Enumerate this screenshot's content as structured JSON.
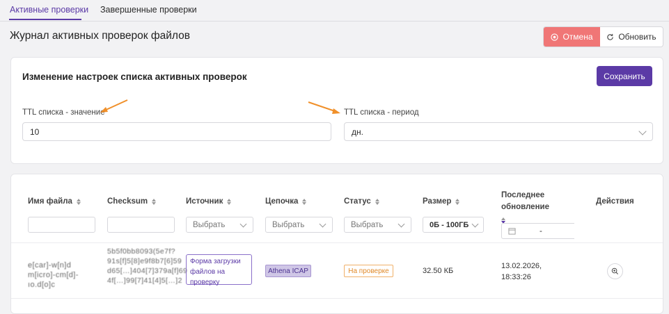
{
  "tabs": [
    {
      "label": "Активные проверки"
    },
    {
      "label": "Завершенные проверки"
    }
  ],
  "page": {
    "title": "Журнал активных проверок файлов"
  },
  "toolbar": {
    "cancel_label": "Отмена",
    "refresh_label": "Обновить"
  },
  "settings": {
    "title": "Изменение настроек списка активных проверок",
    "save_label": "Сохранить",
    "ttl_value": {
      "label": "TTL списка - значение",
      "value": "10"
    },
    "ttl_period": {
      "label": "TTL списка - период",
      "value": "дн."
    }
  },
  "table": {
    "columns": [
      {
        "label": "Имя файла"
      },
      {
        "label": "Checksum"
      },
      {
        "label": "Источник"
      },
      {
        "label": "Цепочка"
      },
      {
        "label": "Статус"
      },
      {
        "label": "Размер"
      },
      {
        "label": "Последнее обновление"
      },
      {
        "label": "Действия"
      }
    ],
    "filters": {
      "placeholder_select": "Выбрать",
      "size_range": "0Б - 100ГБ",
      "date_separator": "-"
    },
    "rows": [
      {
        "filename": "e[car]-w[n]d m[icro]-cm[d]-ıo.d[o]c",
        "checksum": "5b5f0bb8093(5e7f? 91s[f]5[8]e9f8b7[6]59 d65[…]404[7]379a[f]69 4f[…]99[7]41[4]5[…]2",
        "source": "Форма загрузки файлов на проверку",
        "chain": "Athena ICAP",
        "status": "На проверке",
        "size": "32.50 КБ",
        "updated": "13.02.2026, 18:33:26"
      }
    ]
  },
  "colors": {
    "accent": "#5b3aa6",
    "cancel": "#f07676",
    "status": "#e08a2a"
  }
}
